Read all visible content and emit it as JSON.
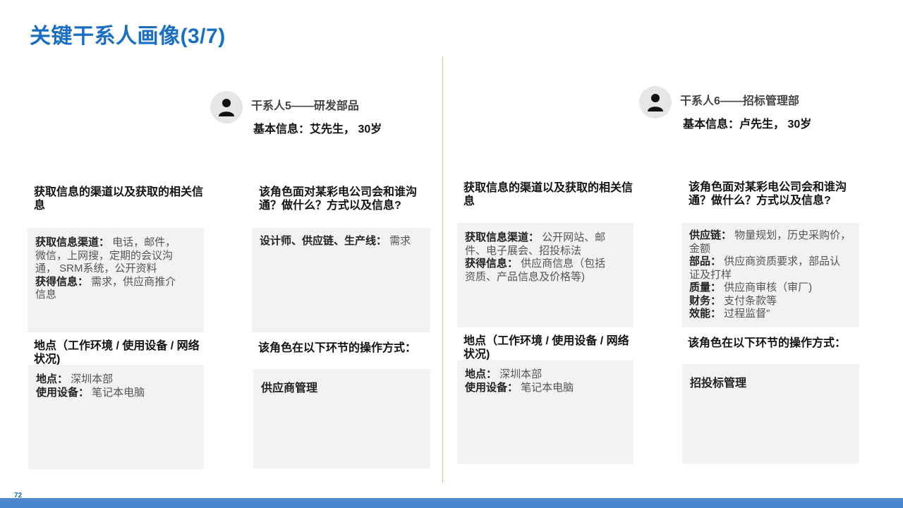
{
  "slide": {
    "title": "关键干系人画像(3/7)",
    "page_number": "72"
  },
  "stakeholder5": {
    "name": "干系人5——研发部品",
    "basic": "基本信息：艾先生，   30岁",
    "channel_heading": "获取信息的渠道以及获取的相关信息",
    "channel_box": {
      "l1_label": "获取信息渠道：",
      "l1_value": "   电话，邮件，",
      "l2": "微信，上网搜，定期的会议沟",
      "l3": "通，  SRM系统，公开资料",
      "l4_label": "获得信息：",
      "l4_value": "   需求，供应商推介",
      "l5": "信息"
    },
    "who_heading": "该角色面对某彩电公司会和谁沟通？做什么？方式以及信息?",
    "who_box": {
      "label": "设计师、供应链、生产线：",
      "value": "   需求"
    },
    "location_heading": "地点（工作环境 / 使用设备 / 网络状况)",
    "location_box": {
      "l1_label": "地点：",
      "l1_value": "   深圳本部",
      "l2_label": "使用设备：",
      "l2_value": "   笔记本电脑"
    },
    "ops_heading": "该角色在以下环节的操作方式：",
    "ops_box": "供应商管理"
  },
  "stakeholder6": {
    "name": "干系人6——招标管理部",
    "basic": "基本信息：卢先生，   30岁",
    "channel_heading": "获取信息的渠道以及获取的相关信息",
    "channel_box": {
      "l1_label": "获取信息渠道：",
      "l1_value": "   公开网站、邮",
      "l2": "件、电子展会、招投标法",
      "l3_label": "获得信息：",
      "l3_value": "   供应商信息（包括",
      "l4": "资质、产品信息及价格等)"
    },
    "who_heading": "该角色面对某彩电公司会和谁沟通？做什么？方式以及信息?",
    "who_box": {
      "l1_label": "供应链：",
      "l1_value": "   物量规划，历史采购价，",
      "l2": "金额",
      "l3_label": "部品：",
      "l3_value": "   供应商资质要求，部品认",
      "l4": "证及打样",
      "l5_label": "质量：",
      "l5_value": "   供应商审核（审厂)",
      "l6_label": "财务：",
      "l6_value": "   支付条款等",
      "l7_label": "效能：",
      "l7_value": "   过程监督\""
    },
    "location_heading": "地点（工作环境 / 使用设备 / 网络状况)",
    "location_box": {
      "l1_label": "地点：",
      "l1_value": "   深圳本部",
      "l2_label": "使用设备：",
      "l2_value": "   笔记本电脑"
    },
    "ops_heading": "该角色在以下环节的操作方式：",
    "ops_box": "招投标管理"
  },
  "colors": {
    "title": "#1a6fc4",
    "box": "#f2f2f2",
    "divider": "#d9c27a",
    "footer": "#4a86d0"
  },
  "icons": {
    "avatar": "person-icon"
  }
}
